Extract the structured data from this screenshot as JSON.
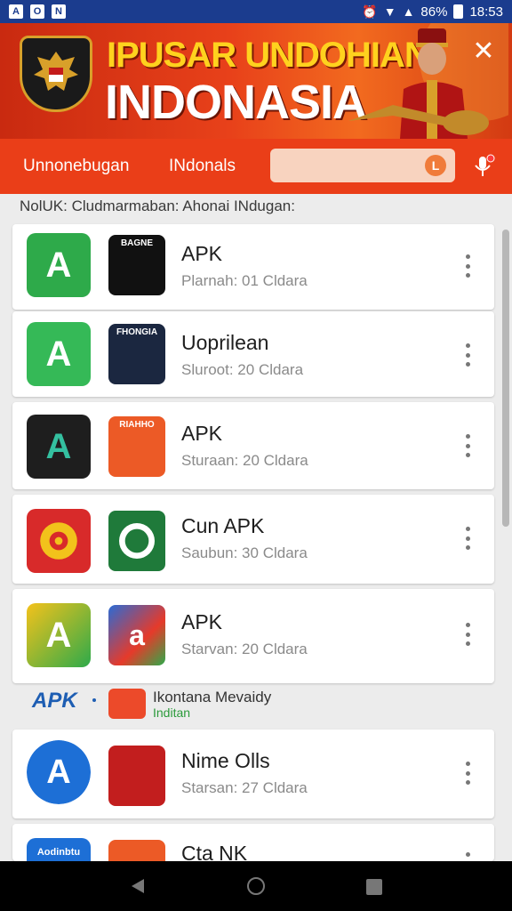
{
  "statusbar": {
    "battery": "86%",
    "time": "18:53",
    "notif_icons": [
      "A",
      "O",
      "N"
    ]
  },
  "banner": {
    "title_line1": "IPUSAR UNDOHIAN",
    "title_line2": "INDONASIA",
    "close_label": "✕"
  },
  "nav": {
    "tab1": "Unnonebugan",
    "tab2": "INdonals",
    "search_placeholder": "",
    "search_icon": "search-icon",
    "mic_icon": "mic-icon"
  },
  "subtitle": "NolUK: Cludmarmaban: Ahonai INdugan:",
  "apps": [
    {
      "title": "APK",
      "subtitle": "Plarnah: 01 Cldara",
      "icon1_text": "A",
      "icon2_text": "BAGNE"
    },
    {
      "title": "Uoprilean",
      "subtitle": "Sluroot: 20 Cldara",
      "icon1_text": "A",
      "icon2_text": "FHONGIA"
    },
    {
      "title": "APK",
      "subtitle": "Sturaan: 20 Cldara",
      "icon1_text": "A",
      "icon2_text": "RIAHHO"
    },
    {
      "title": "Cun APK",
      "subtitle": "Saubun: 30 Cldara",
      "icon1_text": "",
      "icon2_text": ""
    },
    {
      "title": "APK",
      "subtitle": "Starvan: 20 Cldara",
      "icon1_text": "A",
      "icon2_text": "a"
    },
    {
      "title": "Nime Olls",
      "subtitle": "Starsan: 27 Cldara",
      "icon1_text": "A",
      "icon2_text": ""
    },
    {
      "title": "Cta NK",
      "subtitle": "",
      "icon1_text": "Aodinbtu",
      "icon2_text": ""
    }
  ],
  "promo": {
    "label": "APK",
    "line1": "Ikontana Mevaidy",
    "line2": "Inditan"
  },
  "colors": {
    "brand_red": "#ea3e18",
    "statusbar_blue": "#1b3c8e",
    "apk_blue": "#1e5eb3"
  }
}
